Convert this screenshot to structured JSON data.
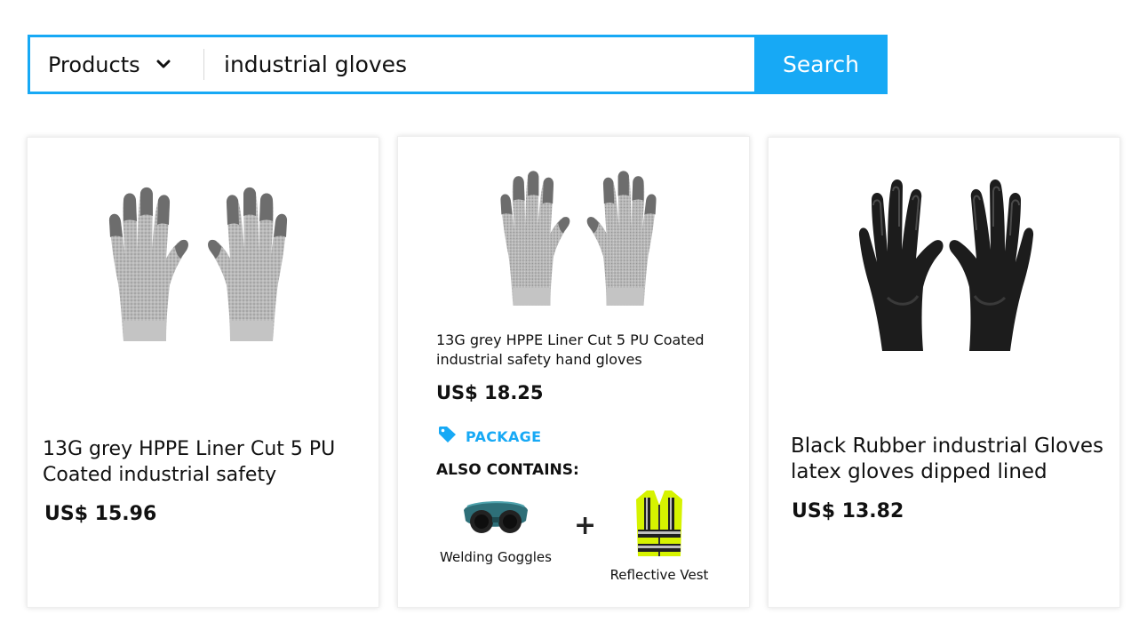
{
  "search": {
    "category": "Products",
    "query": "industrial gloves",
    "button_label": "Search"
  },
  "products": [
    {
      "title": "13G grey HPPE Liner Cut 5 PU Coated industrial safety",
      "price": "US$ 15.96",
      "image_icon": "grey-coated-gloves-image"
    },
    {
      "title": "13G grey HPPE Liner Cut 5 PU Coated industrial safety hand gloves",
      "price": "US$ 18.25",
      "image_icon": "grey-coated-gloves-image",
      "package_label": "PACKAGE",
      "also_contains_label": "ALSO CONTAINS:",
      "bundle": [
        {
          "name": "Welding Goggles",
          "icon": "welding-goggles-image"
        },
        {
          "name": "Reflective Vest",
          "icon": "reflective-vest-image"
        }
      ],
      "plus_symbol": "+"
    },
    {
      "title": "Black Rubber industrial Gloves latex gloves dipped lined",
      "price": "US$ 13.82",
      "image_icon": "black-rubber-gloves-image"
    }
  ],
  "colors": {
    "accent": "#17a9f5",
    "text": "#111111"
  }
}
